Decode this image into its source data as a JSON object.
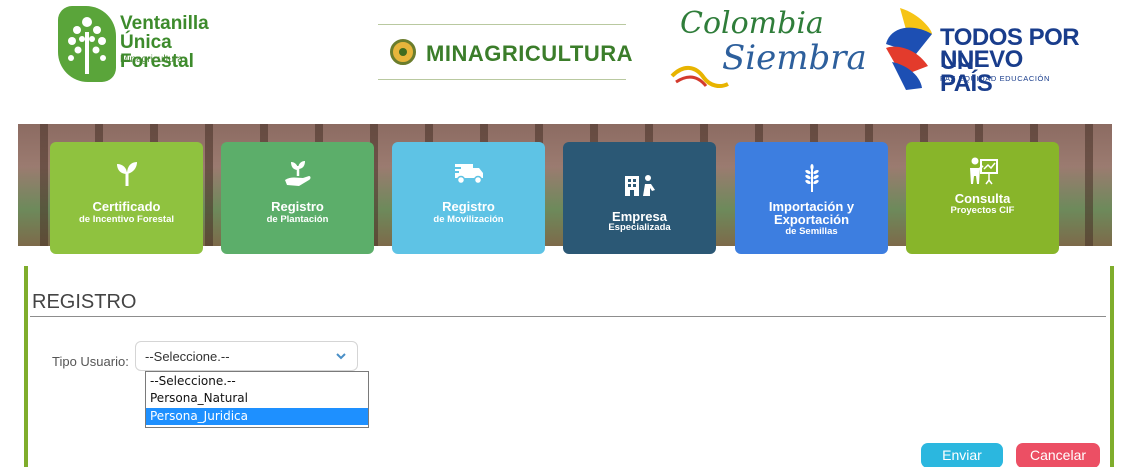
{
  "header": {
    "logo_vuf": {
      "line1": "Ventanilla",
      "line2": "Única Forestal",
      "line3": "Minagricultura"
    },
    "logo_minagricultura": {
      "text": "MINAGRICULTURA"
    },
    "logo_colombia_siembra": {
      "line1": "Colombia",
      "line2": "Siembra"
    },
    "logo_todos_por_un_nuevo_pais": {
      "line1": "TODOS POR UN",
      "line2": "NUEVO PAÍS",
      "line3": "PAZ  EQUIDAD  EDUCACIÓN"
    }
  },
  "tiles": [
    {
      "main": "Certificado",
      "sub": "de Incentivo Forestal",
      "icon": "seedling-icon",
      "color": "#8fc23f"
    },
    {
      "main": "Registro",
      "sub": "de Plantación",
      "icon": "hand-plant-icon",
      "color": "#5cae6a"
    },
    {
      "main": "Registro",
      "sub": "de Movilización",
      "icon": "truck-icon",
      "color": "#5ec3e5"
    },
    {
      "main": "Empresa",
      "sub": "Especializada",
      "icon": "building-person-icon",
      "color": "#2b5875"
    },
    {
      "main": "Importación y",
      "main2": "Exportación",
      "sub": "de Semillas",
      "icon": "wheat-icon",
      "color": "#3d7ee0"
    },
    {
      "main": "Consulta",
      "sub": "Proyectos CIF",
      "icon": "presenter-icon",
      "color": "#88b52a"
    }
  ],
  "form": {
    "title": "REGISTRO",
    "tipo_usuario_label": "Tipo Usuario:",
    "select_value": "--Seleccione.--",
    "options": [
      "--Seleccione.--",
      "Persona_Natural",
      "Persona_Juridica"
    ],
    "highlighted_option": "Persona_Juridica"
  },
  "buttons": {
    "enviar": "Enviar",
    "cancelar": "Cancelar"
  },
  "colors": {
    "panel_border": "#7fad2c",
    "enviar": "#2bb7df",
    "cancelar": "#ec4f64",
    "highlight": "#1e90ff"
  }
}
